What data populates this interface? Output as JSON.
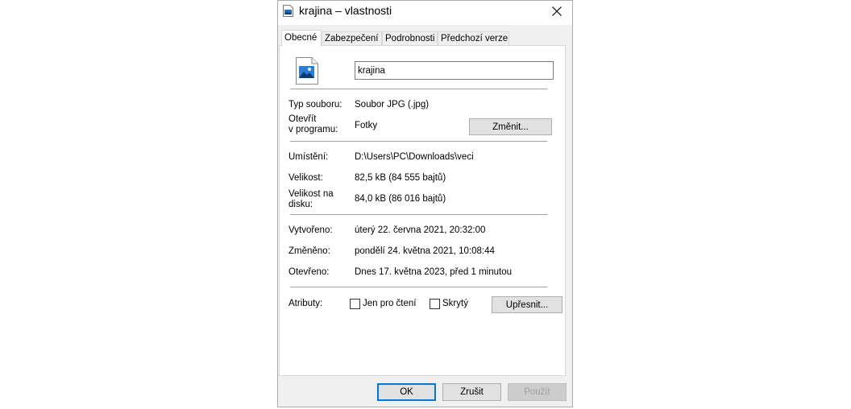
{
  "window": {
    "title": "krajina – vlastnosti"
  },
  "tabs": [
    {
      "label": "Obecné",
      "active": true
    },
    {
      "label": "Zabezpečení",
      "active": false
    },
    {
      "label": "Podrobnosti",
      "active": false
    },
    {
      "label": "Předchozí verze",
      "active": false
    }
  ],
  "general": {
    "file_name": "krajina",
    "file_type": {
      "label": "Typ souboru:",
      "value": "Soubor JPG (.jpg)"
    },
    "opens_with": {
      "label_line1": "Otevřít",
      "label_line2": "v programu:",
      "value": "Fotky",
      "change_button": "Změnit..."
    },
    "location": {
      "label": "Umístění:",
      "value": "D:\\Users\\PC\\Downloads\\veci"
    },
    "size": {
      "label": "Velikost:",
      "value": "82,5 kB (84 555 bajtů)"
    },
    "size_on_disk": {
      "label_line1": "Velikost na",
      "label_line2": "disku:",
      "value": "84,0 kB (86 016 bajtů)"
    },
    "created": {
      "label": "Vytvořeno:",
      "value": "úterý 22. června 2021, 20:32:00"
    },
    "modified": {
      "label": "Změněno:",
      "value": "pondělí 24. května 2021, 10:08:44"
    },
    "accessed": {
      "label": "Otevřeno:",
      "value": "Dnes 17. května 2023, před 1 minutou"
    },
    "attributes": {
      "label": "Atributy:",
      "read_only": {
        "label": "Jen pro čtení",
        "checked": false
      },
      "hidden": {
        "label": "Skrytý",
        "checked": false
      },
      "advanced_button": "Upřesnit..."
    }
  },
  "footer": {
    "ok": "OK",
    "cancel": "Zrušit",
    "apply": "Použít"
  },
  "colors": {
    "accent": "#0078d7",
    "dialog_bg": "#f0f0f0",
    "button_bg": "#e1e1e1",
    "image_icon_blue": "#1e6fc2"
  },
  "icons": {
    "title": "image-file-icon",
    "close": "close-icon",
    "file": "jpg-file-icon"
  }
}
